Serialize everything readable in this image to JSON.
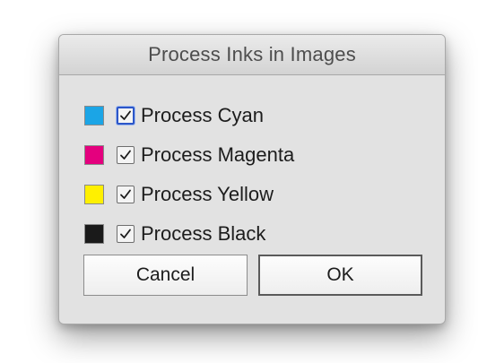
{
  "dialog": {
    "title": "Process Inks in Images"
  },
  "inks": [
    {
      "label": "Process Cyan",
      "color": "#1ba5e6",
      "checked": true,
      "focused": true
    },
    {
      "label": "Process Magenta",
      "color": "#e4007e",
      "checked": true,
      "focused": false
    },
    {
      "label": "Process Yellow",
      "color": "#fff000",
      "checked": true,
      "focused": false
    },
    {
      "label": "Process Black",
      "color": "#1a1a1a",
      "checked": true,
      "focused": false
    }
  ],
  "buttons": {
    "cancel_label": "Cancel",
    "ok_label": "OK"
  },
  "icons": {
    "check": "checkmark-icon"
  }
}
